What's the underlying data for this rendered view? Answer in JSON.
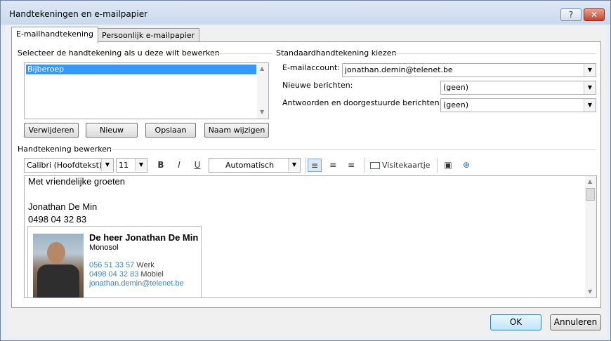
{
  "window": {
    "title": "Handtekeningen en e-mailpapier",
    "help": "?",
    "close": "✕"
  },
  "tabs": [
    {
      "label": "E-mailhandtekening",
      "active": true
    },
    {
      "label": "Persoonlijk e-mailpapier",
      "active": false
    }
  ],
  "select_section": {
    "label": "Selecteer de handtekening als u deze wilt bewerken",
    "items": [
      "Bijberoep"
    ],
    "buttons": {
      "delete": "Verwijderen",
      "new": "Nieuw",
      "save": "Opslaan",
      "rename": "Naam wijzigen"
    }
  },
  "default_section": {
    "label": "Standaardhandtekening kiezen",
    "account_label": "E-mailaccount:",
    "account_value": "jonathan.demin@telenet.be",
    "new_msgs_label": "Nieuwe berichten:",
    "new_msgs_value": "(geen)",
    "replies_label": "Antwoorden en doorgestuurde berichten:",
    "replies_value": "(geen)"
  },
  "edit_section": {
    "label": "Handtekening bewerken",
    "font": "Calibri (Hoofdtekst)",
    "size": "11",
    "color": "Automatisch",
    "business_card": "Visitekaartje",
    "bold": "B",
    "italic": "I",
    "underline": "U"
  },
  "signature": {
    "greeting": "Met vriendelijke groeten",
    "name": "Jonathan De Min",
    "phone": "0498 04 32 83",
    "card": {
      "title": "De heer Jonathan De Min",
      "company": "Monosol",
      "work_phone": "056 51 33 57",
      "work_label": "Werk",
      "mobile_phone": "0498 04 32 83",
      "mobile_label": "Mobiel",
      "email": "jonathan.demin@telenet.be"
    }
  },
  "footer": {
    "ok": "OK",
    "cancel": "Annuleren"
  }
}
